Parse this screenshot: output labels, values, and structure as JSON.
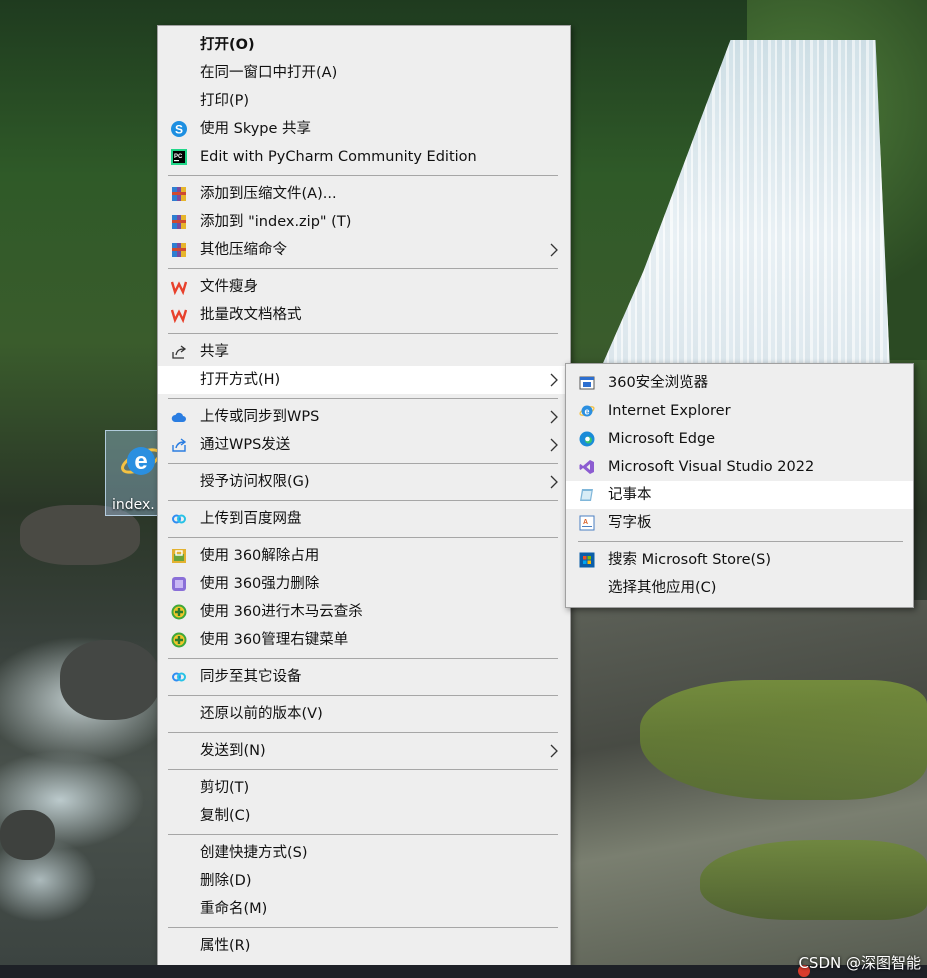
{
  "desktop": {
    "icon_label": "index."
  },
  "context_menu": {
    "items": [
      {
        "label": "打开(O)",
        "icon": "none",
        "bold": true
      },
      {
        "label": "在同一窗口中打开(A)",
        "icon": "none"
      },
      {
        "label": "打印(P)",
        "icon": "none"
      },
      {
        "label": "使用 Skype 共享",
        "icon": "skype-icon"
      },
      {
        "label": "Edit with PyCharm Community Edition",
        "icon": "pycharm-icon"
      },
      {
        "label": "添加到压缩文件(A)...",
        "icon": "winrar-icon"
      },
      {
        "label": "添加到 \"index.zip\" (T)",
        "icon": "winrar-icon"
      },
      {
        "label": "其他压缩命令",
        "icon": "winrar-icon",
        "submenu": true
      },
      {
        "label": "文件瘦身",
        "icon": "wps-icon"
      },
      {
        "label": "批量改文档格式",
        "icon": "wps-icon"
      },
      {
        "label": "共享",
        "icon": "share-icon"
      },
      {
        "label": "打开方式(H)",
        "icon": "none",
        "submenu": true,
        "highlighted": true
      },
      {
        "label": "上传或同步到WPS",
        "icon": "wps-cloud-icon",
        "submenu": true
      },
      {
        "label": "通过WPS发送",
        "icon": "wps-send-icon",
        "submenu": true
      },
      {
        "label": "授予访问权限(G)",
        "icon": "none",
        "submenu": true
      },
      {
        "label": "上传到百度网盘",
        "icon": "baidu-netdisk-icon"
      },
      {
        "label": "使用 360解除占用",
        "icon": "360-unlock-icon"
      },
      {
        "label": "使用 360强力删除",
        "icon": "360-delete-icon"
      },
      {
        "label": "使用 360进行木马云查杀",
        "icon": "360-scan-icon"
      },
      {
        "label": "使用 360管理右键菜单",
        "icon": "360-manage-icon"
      },
      {
        "label": "同步至其它设备",
        "icon": "baidu-sync-icon"
      },
      {
        "label": "还原以前的版本(V)",
        "icon": "none"
      },
      {
        "label": "发送到(N)",
        "icon": "none",
        "submenu": true
      },
      {
        "label": "剪切(T)",
        "icon": "none"
      },
      {
        "label": "复制(C)",
        "icon": "none"
      },
      {
        "label": "创建快捷方式(S)",
        "icon": "none"
      },
      {
        "label": "删除(D)",
        "icon": "none"
      },
      {
        "label": "重命名(M)",
        "icon": "none"
      },
      {
        "label": "属性(R)",
        "icon": "none"
      }
    ]
  },
  "open_with_submenu": {
    "items": [
      {
        "label": "360安全浏览器",
        "icon": "360-browser-icon"
      },
      {
        "label": "Internet Explorer",
        "icon": "internet-explorer-icon"
      },
      {
        "label": "Microsoft Edge",
        "icon": "edge-icon"
      },
      {
        "label": "Microsoft Visual Studio 2022",
        "icon": "visual-studio-icon"
      },
      {
        "label": "记事本",
        "icon": "notepad-icon",
        "highlighted": true
      },
      {
        "label": "写字板",
        "icon": "wordpad-icon"
      },
      {
        "label": "搜索 Microsoft Store(S)",
        "icon": "store-icon"
      },
      {
        "label": "选择其他应用(C)",
        "icon": "none"
      }
    ]
  },
  "watermark": "CSDN @深图智能"
}
